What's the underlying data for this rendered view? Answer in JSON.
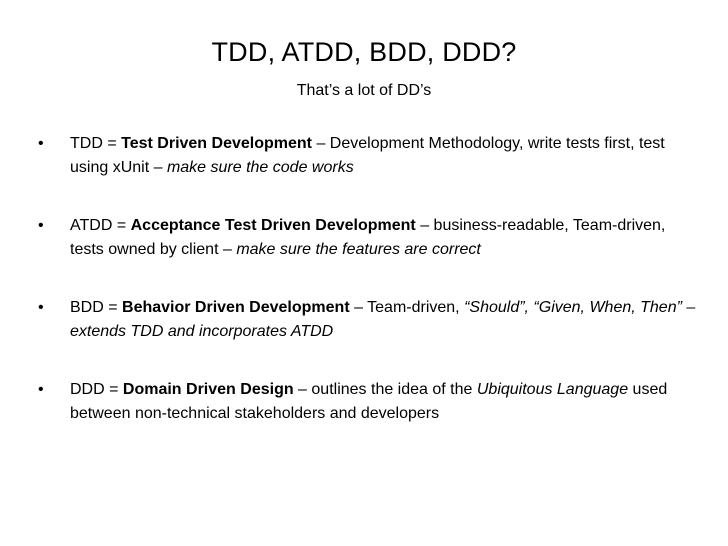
{
  "slide": {
    "title": "TDD, ATDD, BDD, DDD?",
    "subtitle": "That’s a lot of DD’s",
    "bullet_symbol": "•",
    "bullets": [
      {
        "abbr": "TDD = ",
        "term": "Test Driven Development",
        "desc": " – Development Methodology, write tests first, test using xUnit – ",
        "emph": "make sure the code works",
        "tail": ""
      },
      {
        "abbr": "ATDD = ",
        "term": "Acceptance Test Driven Development",
        "desc": " – business-readable, Team-driven, tests owned by client – ",
        "emph": "make sure the features are correct",
        "tail": ""
      },
      {
        "abbr": "BDD = ",
        "term": "Behavior Driven Development",
        "desc": " – Team-driven, ",
        "emph": "“Should”, “Given, When, Then” – extends TDD and incorporates ATDD",
        "tail": ""
      },
      {
        "abbr": "DDD = ",
        "term": "Domain Driven Design",
        "desc": " – outlines the idea of the ",
        "emph": "Ubiquitous Language",
        "tail": " used between non-technical stakeholders and developers"
      }
    ]
  }
}
